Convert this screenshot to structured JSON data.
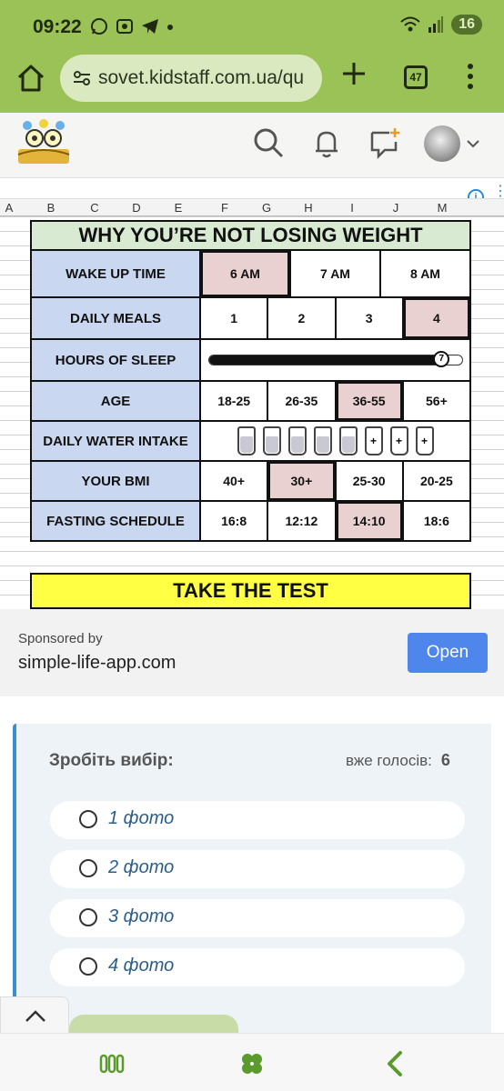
{
  "status": {
    "time": "09:22",
    "battery": "16"
  },
  "browser": {
    "url": "sovet.kidstaff.com.ua/qu",
    "tab_count": "47"
  },
  "ad": {
    "columns": [
      "A",
      "B",
      "C",
      "D",
      "E",
      "F",
      "G",
      "H",
      "I",
      "J",
      "M"
    ],
    "title": "WHY YOU’RE NOT LOSING WEIGHT",
    "rows": {
      "wake": {
        "label": "WAKE UP TIME",
        "options": [
          "6 AM",
          "7 AM",
          "8 AM"
        ],
        "selected": 0
      },
      "meals": {
        "label": "DAILY MEALS",
        "options": [
          "1",
          "2",
          "3",
          "4"
        ],
        "selected": 3
      },
      "sleep": {
        "label": "HOURS OF SLEEP",
        "value": 7,
        "fill_fraction": 0.92
      },
      "age": {
        "label": "AGE",
        "options": [
          "18-25",
          "26-35",
          "36-55",
          "56+"
        ],
        "selected": 2
      },
      "water": {
        "label": "DAILY WATER INTAKE",
        "full_glasses": 5,
        "plus_label": "+"
      },
      "bmi": {
        "label": "YOUR BMI",
        "options": [
          "40+",
          "30+",
          "25-30",
          "20-25"
        ],
        "selected": 1
      },
      "fasting": {
        "label": "FASTING SCHEDULE",
        "options": [
          "16:8",
          "12:12",
          "14:10",
          "18:6"
        ],
        "selected": 2
      }
    },
    "cta": "TAKE THE TEST"
  },
  "sponsor": {
    "by_label": "Sponsored by",
    "domain": "simple-life-app.com",
    "open_label": "Open",
    "open_color": "#4f86ec"
  },
  "poll": {
    "question": "Зробіть вибір:",
    "votes_label": "вже голосів:",
    "votes_count": "6",
    "choices": [
      "1 фото",
      "2 фото",
      "3 фото",
      "4 фото"
    ]
  },
  "colors": {
    "chrome": "#9bc257",
    "selected_cell": "#ead1d1",
    "label_cell": "#c9d7f0",
    "title_cell": "#d9ead3",
    "cta_bg": "#ffff44",
    "poll_accent": "#3c8ed1"
  }
}
